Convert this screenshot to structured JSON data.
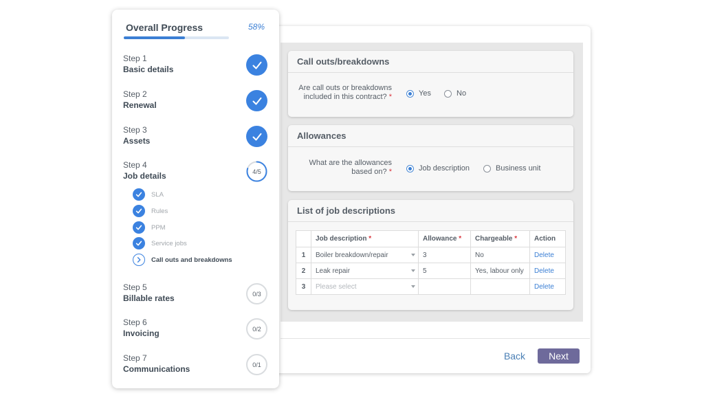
{
  "progress": {
    "title": "Overall Progress",
    "percent_label": "58%",
    "percent": 58,
    "steps": [
      {
        "number": "Step 1",
        "name": "Basic details",
        "status": "done",
        "badge": ""
      },
      {
        "number": "Step 2",
        "name": "Renewal",
        "status": "done",
        "badge": ""
      },
      {
        "number": "Step 3",
        "name": "Assets",
        "status": "done",
        "badge": ""
      },
      {
        "number": "Step 4",
        "name": "Job details",
        "status": "in-progress",
        "badge": "4/5",
        "fraction": 0.8
      },
      {
        "number": "Step 5",
        "name": "Billable rates",
        "status": "todo",
        "badge": "0/3"
      },
      {
        "number": "Step 6",
        "name": "Invoicing",
        "status": "todo",
        "badge": "0/2"
      },
      {
        "number": "Step 7",
        "name": "Communications",
        "status": "todo",
        "badge": "0/1"
      }
    ],
    "substeps": [
      {
        "label": "SLA",
        "status": "done"
      },
      {
        "label": "Rules",
        "status": "done"
      },
      {
        "label": "PPM",
        "status": "done"
      },
      {
        "label": "Service jobs",
        "status": "done"
      },
      {
        "label": "Call outs and breakdowns",
        "status": "current"
      }
    ]
  },
  "callouts": {
    "title": "Call outs/breakdowns",
    "question_line1": "Are call outs or breakdowns",
    "question_line2": "included in this contract?",
    "required_mark": "*",
    "options": [
      {
        "label": "Yes",
        "selected": true
      },
      {
        "label": "No",
        "selected": false
      }
    ]
  },
  "allowances": {
    "title": "Allowances",
    "question_line1": "What are the allowances",
    "question_line2": "based on?",
    "required_mark": "*",
    "options": [
      {
        "label": "Job description",
        "selected": true
      },
      {
        "label": "Business unit",
        "selected": false
      }
    ]
  },
  "job_list": {
    "title": "List of job descriptions",
    "headers": {
      "job_description": "Job description",
      "allowance": "Allowance",
      "chargeable": "Chargeable",
      "action": "Action",
      "required_mark": "*"
    },
    "rows": [
      {
        "num": "1",
        "job": "Boiler breakdown/repair",
        "allowance": "3",
        "chargeable": "No",
        "action": "Delete"
      },
      {
        "num": "2",
        "job": "Leak repair",
        "allowance": "5",
        "chargeable": "Yes, labour only",
        "action": "Delete"
      },
      {
        "num": "3",
        "job": "",
        "placeholder": "Please select",
        "allowance": "",
        "chargeable": "",
        "action": "Delete"
      }
    ]
  },
  "footer": {
    "back_label": "Back",
    "next_label": "Next"
  },
  "colors": {
    "accent": "#3b7fd4",
    "next_button": "#6e6a9b",
    "required": "#d9363e"
  }
}
